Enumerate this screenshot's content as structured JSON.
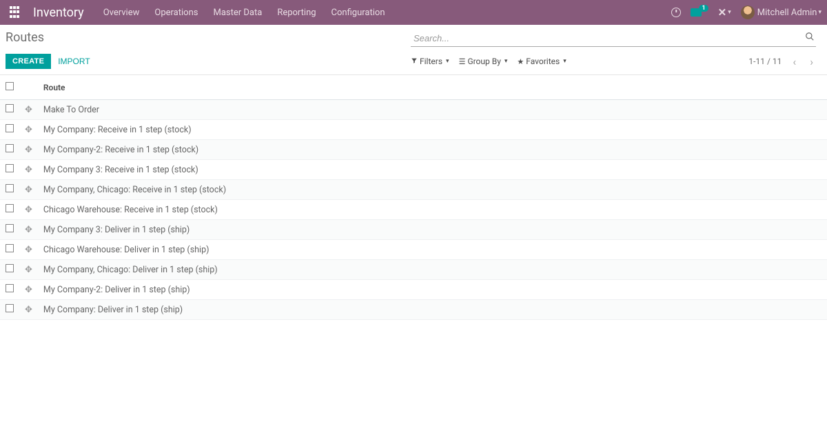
{
  "navbar": {
    "brand": "Inventory",
    "links": [
      "Overview",
      "Operations",
      "Master Data",
      "Reporting",
      "Configuration"
    ],
    "chat_badge": "1",
    "user_name": "Mitchell Admin"
  },
  "breadcrumb": "Routes",
  "search": {
    "placeholder": "Search..."
  },
  "buttons": {
    "create": "CREATE",
    "import": "IMPORT"
  },
  "filters": {
    "filters": "Filters",
    "groupby": "Group By",
    "favorites": "Favorites"
  },
  "pager": {
    "range": "1-11 / 11"
  },
  "table": {
    "header_route": "Route",
    "rows": [
      {
        "name": "Make To Order"
      },
      {
        "name": "My Company: Receive in 1 step (stock)"
      },
      {
        "name": "My Company-2: Receive in 1 step (stock)"
      },
      {
        "name": "My Company 3: Receive in 1 step (stock)"
      },
      {
        "name": "My Company, Chicago: Receive in 1 step (stock)"
      },
      {
        "name": "Chicago Warehouse: Receive in 1 step (stock)"
      },
      {
        "name": "My Company 3: Deliver in 1 step (ship)"
      },
      {
        "name": "Chicago Warehouse: Deliver in 1 step (ship)"
      },
      {
        "name": "My Company, Chicago: Deliver in 1 step (ship)"
      },
      {
        "name": "My Company-2: Deliver in 1 step (ship)"
      },
      {
        "name": "My Company: Deliver in 1 step (ship)"
      }
    ]
  }
}
